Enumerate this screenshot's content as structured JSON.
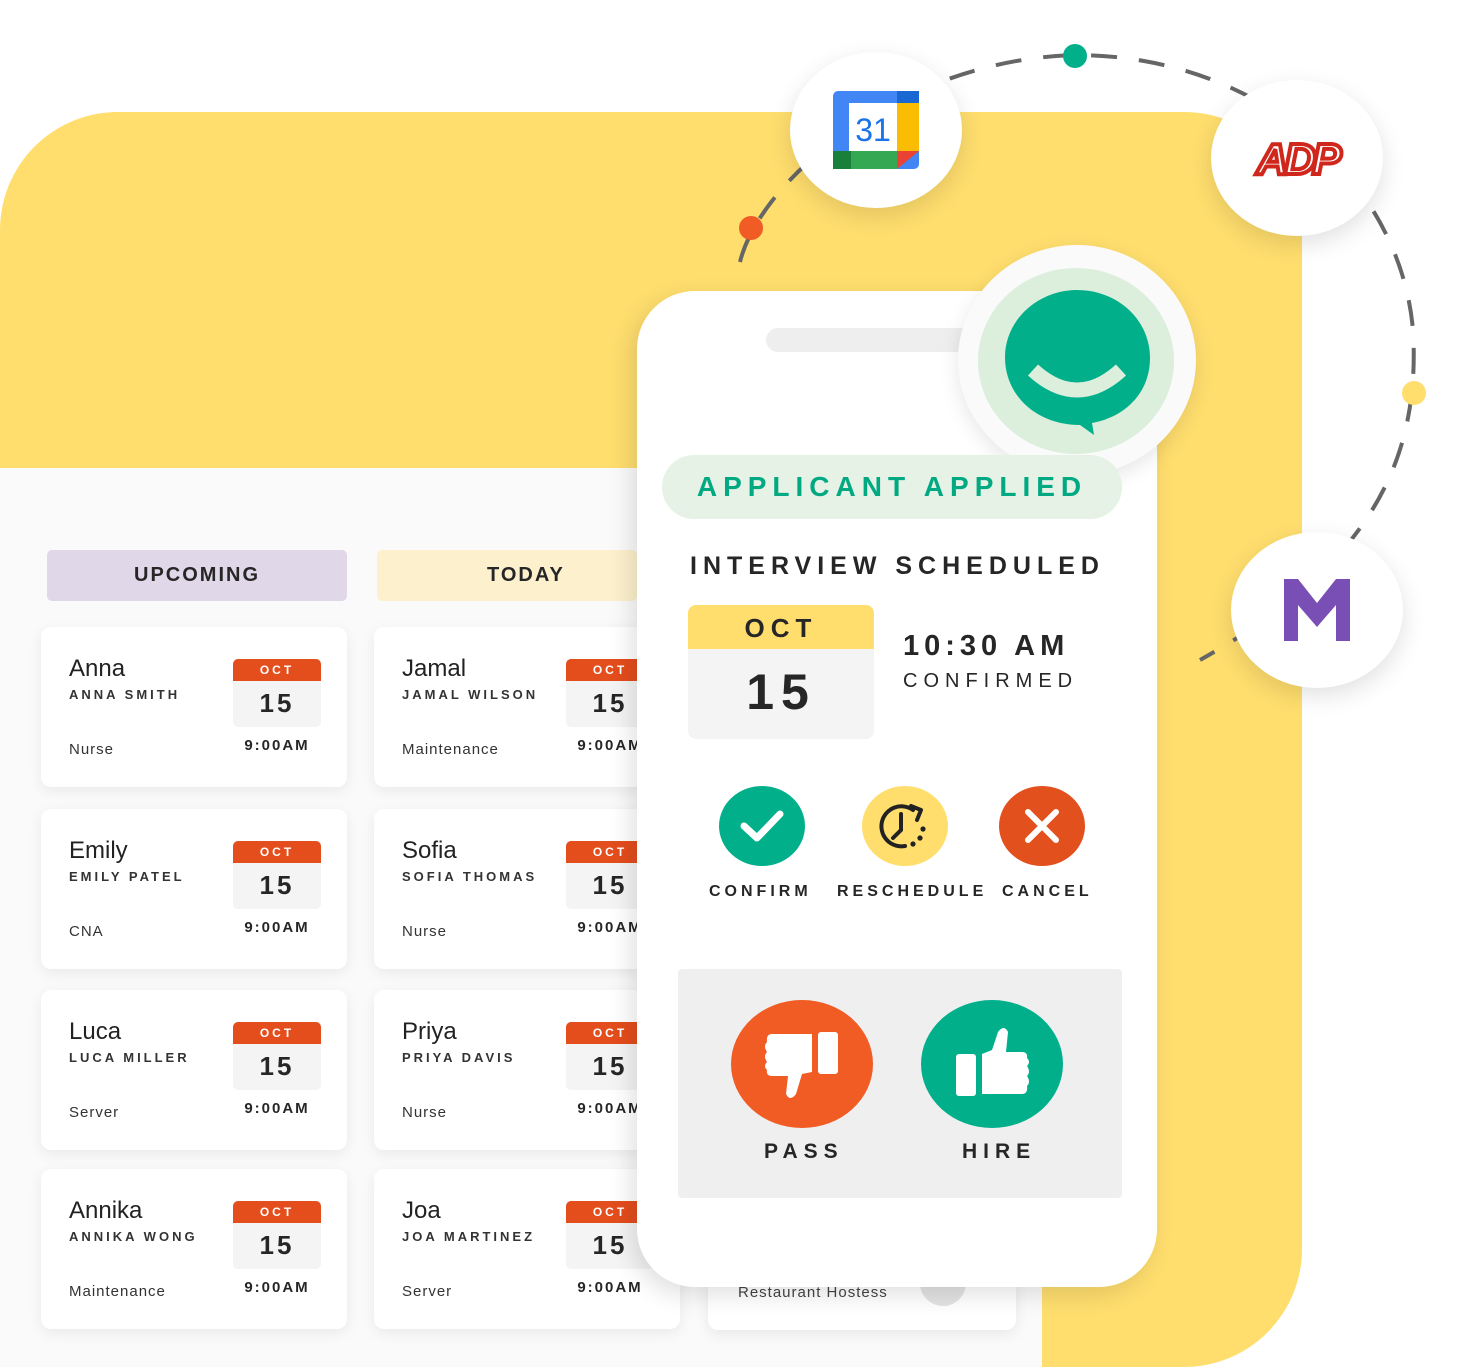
{
  "columns": [
    {
      "label": "UPCOMING",
      "color": "#e0d7e9"
    },
    {
      "label": "TODAY",
      "color": "#fcf1cc"
    }
  ],
  "upcoming_cards": [
    {
      "first": "Anna",
      "full": "ANNA SMITH",
      "role": "Nurse",
      "month": "OCT",
      "day": "15",
      "time": "9:00AM"
    },
    {
      "first": "Emily",
      "full": "EMILY PATEL",
      "role": "CNA",
      "month": "OCT",
      "day": "15",
      "time": "9:00AM"
    },
    {
      "first": "Luca",
      "full": "LUCA MILLER",
      "role": "Server",
      "month": "OCT",
      "day": "15",
      "time": "9:00AM"
    },
    {
      "first": "Annika",
      "full": "ANNIKA WONG",
      "role": "Maintenance",
      "month": "OCT",
      "day": "15",
      "time": "9:00AM"
    }
  ],
  "today_cards": [
    {
      "first": "Jamal",
      "full": "JAMAL WILSON",
      "role": "Maintenance",
      "month": "OCT",
      "day": "15",
      "time": "9:00AM"
    },
    {
      "first": "Sofia",
      "full": "SOFIA THOMAS",
      "role": "Nurse",
      "month": "OCT",
      "day": "15",
      "time": "9:00AM"
    },
    {
      "first": "Priya",
      "full": "PRIYA DAVIS",
      "role": "Nurse",
      "month": "OCT",
      "day": "15",
      "time": "9:00AM"
    },
    {
      "first": "Joa",
      "full": "JOA MARTINEZ",
      "role": "Server",
      "month": "OCT",
      "day": "15",
      "time": "9:00AM"
    }
  ],
  "partial_card": {
    "role": "Restaurant Hostess"
  },
  "phone": {
    "status_pill": "APPLICANT APPLIED",
    "title": "INTERVIEW SCHEDULED",
    "calendar": {
      "month": "OCT",
      "day": "15"
    },
    "time": "10:30 AM",
    "status": "CONFIRMED",
    "actions": [
      {
        "label": "CONFIRM",
        "icon": "check-icon",
        "color": "#01b08b"
      },
      {
        "label": "RESCHEDULE",
        "icon": "clock-reschedule-icon",
        "color": "#ffde6e"
      },
      {
        "label": "CANCEL",
        "icon": "x-icon",
        "color": "#e2501d"
      }
    ],
    "decisions": [
      {
        "label": "PASS",
        "icon": "thumbs-down-icon",
        "color": "#f15b24"
      },
      {
        "label": "HIRE",
        "icon": "thumbs-up-icon",
        "color": "#01b08b"
      }
    ]
  },
  "integrations": [
    {
      "name": "Google Calendar",
      "text": "31",
      "icon": "google-calendar-icon"
    },
    {
      "name": "ADP",
      "text": "ADP",
      "icon": "adp-logo-icon"
    },
    {
      "name": "M",
      "text": "M",
      "icon": "m-logo-icon"
    }
  ],
  "colors": {
    "brand_green": "#01b08b",
    "brand_yellow": "#ffde6e",
    "alert_orange": "#e44d1c",
    "adp_red": "#d0271d",
    "m_purple": "#7a4fb5"
  }
}
